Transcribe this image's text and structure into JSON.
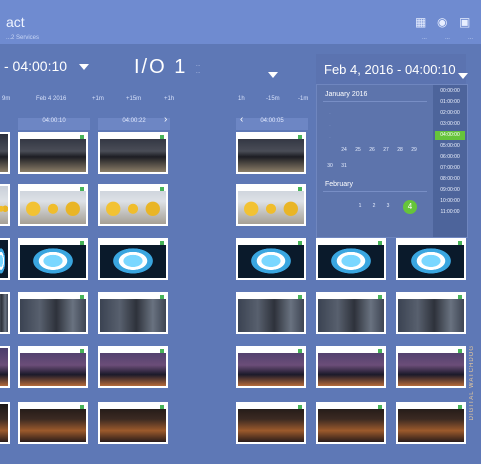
{
  "header": {
    "title": "act",
    "subtitle": "...2 Services",
    "meta": [
      "...",
      "...",
      "..."
    ],
    "icons": [
      "grid-icon",
      "settings-icon",
      "document-icon"
    ]
  },
  "controls": {
    "left_time": "- 04:00:10",
    "io_label": "I/O 1",
    "io_sub_line1": "...",
    "io_sub_line2": "...",
    "datetime_label": "Feb 4, 2016 - 04:00:10"
  },
  "timeline": {
    "labels": [
      "9m",
      "Feb 4 2016",
      "+1m",
      "+15m",
      "+1h",
      "1h",
      "-15m",
      "-1m"
    ]
  },
  "columns": {
    "col1_time": "04:00:10",
    "col2_time": "04:00:22",
    "col3_time": "04:00:05"
  },
  "calendar": {
    "month1": "January 2016",
    "month1_days": [
      "24",
      "25",
      "26",
      "27",
      "28",
      "29"
    ],
    "month1_tail": [
      "30",
      "31"
    ],
    "month2": "February",
    "month2_days": [
      "1",
      "2",
      "3"
    ],
    "selected_day": "4",
    "times": [
      "00:00:00",
      "01:00:00",
      "02:00:00",
      "03:00:00",
      "04:00:00",
      "05:00:00",
      "06:00:00",
      "07:00:00",
      "08:00:00",
      "09:00:00",
      "10:00:00",
      "11:00:00"
    ],
    "active_time_index": 4
  },
  "side_watermark": "DIGITAL WATCHDOG"
}
